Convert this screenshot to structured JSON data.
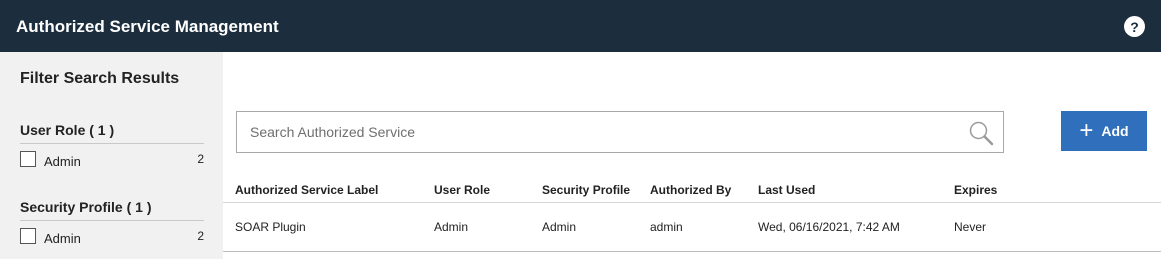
{
  "header": {
    "title": "Authorized Service Management",
    "help_label": "?"
  },
  "sidebar": {
    "title": "Filter Search Results",
    "facets": [
      {
        "title": "User Role ( 1 )",
        "options": [
          {
            "label": "Admin",
            "count": "2"
          }
        ]
      },
      {
        "title": "Security Profile ( 1 )",
        "options": [
          {
            "label": "Admin",
            "count": "2"
          }
        ]
      }
    ]
  },
  "search": {
    "placeholder": "Search Authorized Service",
    "value": ""
  },
  "toolbar": {
    "add_label": "Add"
  },
  "table": {
    "columns": [
      "Authorized Service Label",
      "User Role",
      "Security Profile",
      "Authorized By",
      "Last Used",
      "Expires"
    ],
    "rows": [
      [
        "SOAR Plugin",
        "Admin",
        "Admin",
        "admin",
        "Wed, 06/16/2021, 7:42 AM",
        "Never"
      ]
    ]
  },
  "colors": {
    "header_bg": "#1c2d3e",
    "accent": "#2f6fbb",
    "sidebar_bg": "#f1f1f1"
  }
}
